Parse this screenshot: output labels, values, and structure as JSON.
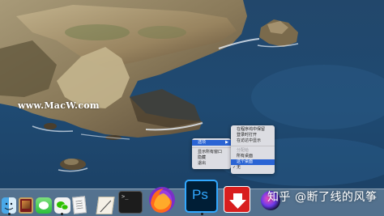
{
  "wallpaper": {
    "watermark_text": "www.MacW.com"
  },
  "context_menu": {
    "items": [
      {
        "label": "选项",
        "has_submenu": true,
        "highlighted": true
      },
      {
        "label": "显示所有窗口",
        "has_submenu": false,
        "highlighted": false
      },
      {
        "label": "隐藏",
        "has_submenu": false,
        "highlighted": false
      },
      {
        "label": "退出",
        "has_submenu": false,
        "highlighted": false
      }
    ]
  },
  "options_submenu": {
    "items": [
      {
        "label": "在程序坞中保留",
        "checked": false
      },
      {
        "label": "登录时打开",
        "checked": false
      },
      {
        "label": "在访达中显示",
        "checked": false
      }
    ],
    "assign_header": "分配给",
    "assign_items": [
      {
        "label": "所有桌面",
        "checked": false,
        "highlighted": false
      },
      {
        "label": "这个桌面",
        "checked": false,
        "highlighted": true
      },
      {
        "label": "无",
        "checked": true,
        "highlighted": false
      }
    ]
  },
  "dock": {
    "apps": [
      "finder-app",
      "photo-booth-app",
      "messages-app",
      "wechat-app",
      "document-app",
      "notes-app",
      "terminal-app",
      "firefox-app",
      "photoshop-app",
      "downloader-app",
      "siri-app"
    ],
    "photoshop_label": "Ps",
    "terminal_label": ">_"
  },
  "overlay_watermark": "知乎 @断了线的风筝",
  "colors": {
    "menu_highlight": "#2a64d4",
    "photoshop_bg": "#001e36",
    "photoshop_text": "#31a8ff",
    "downloader_bg": "#d81e1e"
  }
}
